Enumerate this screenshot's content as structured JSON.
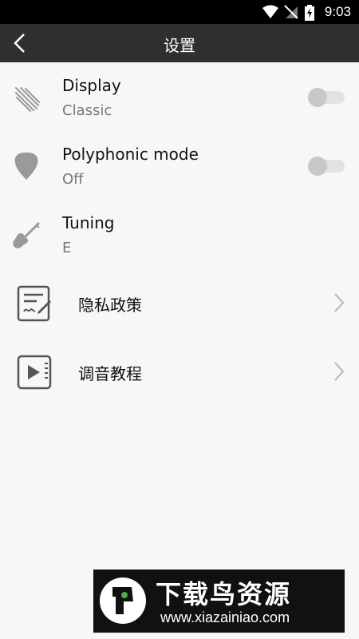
{
  "status_bar": {
    "time": "9:03"
  },
  "app_bar": {
    "title": "设置"
  },
  "settings": [
    {
      "label": "Display",
      "value": "Classic",
      "icon": "comet-icon",
      "toggle_on": false
    },
    {
      "label": "Polyphonic mode",
      "value": "Off",
      "icon": "guitar-pick-icon",
      "toggle_on": false
    },
    {
      "label": "Tuning",
      "value": "E",
      "icon": "electric-guitar-icon"
    }
  ],
  "nav_items": [
    {
      "label": "隐私政策",
      "icon": "document-edit-icon"
    },
    {
      "label": "调音教程",
      "icon": "video-tutorial-icon"
    }
  ],
  "watermark": {
    "title": "下载鸟资源",
    "url": "www.xiazainiao.com"
  }
}
